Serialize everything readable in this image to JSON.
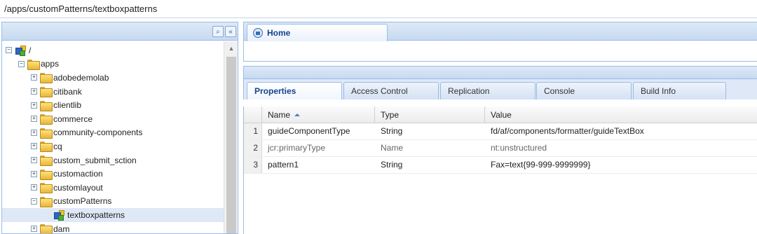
{
  "address": {
    "value": "/apps/customPatterns/textboxpatterns"
  },
  "tree": {
    "scroll_up_glyph": "▲",
    "buttons": {
      "find_glyph": "⌕",
      "collapse_glyph": "«"
    },
    "nodes": [
      {
        "label": "/",
        "toggle": "−",
        "icon": "node"
      },
      {
        "label": "apps",
        "toggle": "−",
        "icon": "folder"
      },
      {
        "label": "adobedemolab",
        "toggle": "+",
        "icon": "folder"
      },
      {
        "label": "citibank",
        "toggle": "+",
        "icon": "folder"
      },
      {
        "label": "clientlib",
        "toggle": "+",
        "icon": "folder"
      },
      {
        "label": "commerce",
        "toggle": "+",
        "icon": "folder"
      },
      {
        "label": "community-components",
        "toggle": "+",
        "icon": "folder"
      },
      {
        "label": "cq",
        "toggle": "+",
        "icon": "folder"
      },
      {
        "label": "custom_submit_sction",
        "toggle": "+",
        "icon": "folder"
      },
      {
        "label": "customaction",
        "toggle": "+",
        "icon": "folder"
      },
      {
        "label": "customlayout",
        "toggle": "+",
        "icon": "folder"
      },
      {
        "label": "customPatterns",
        "toggle": "−",
        "icon": "folder"
      },
      {
        "label": "textboxpatterns",
        "toggle": "",
        "icon": "node",
        "selected": true
      },
      {
        "label": "dam",
        "toggle": "+",
        "icon": "folder"
      }
    ]
  },
  "home_tab": {
    "label": "Home"
  },
  "sub_tabs": [
    {
      "label": "Properties",
      "active": true
    },
    {
      "label": "Access Control"
    },
    {
      "label": "Replication"
    },
    {
      "label": "Console"
    },
    {
      "label": "Build Info"
    }
  ],
  "grid": {
    "columns": [
      "Name",
      "Type",
      "Value"
    ],
    "rows": [
      {
        "num": "1",
        "name": "guideComponentType",
        "type": "String",
        "value": "fd/af/components/formatter/guideTextBox",
        "muted": false
      },
      {
        "num": "2",
        "name": "jcr:primaryType",
        "type": "Name",
        "value": "nt:unstructured",
        "muted": true
      },
      {
        "num": "3",
        "name": "pattern1",
        "type": "String",
        "value": "Fax=text{99-999-9999999}",
        "muted": false
      }
    ]
  }
}
